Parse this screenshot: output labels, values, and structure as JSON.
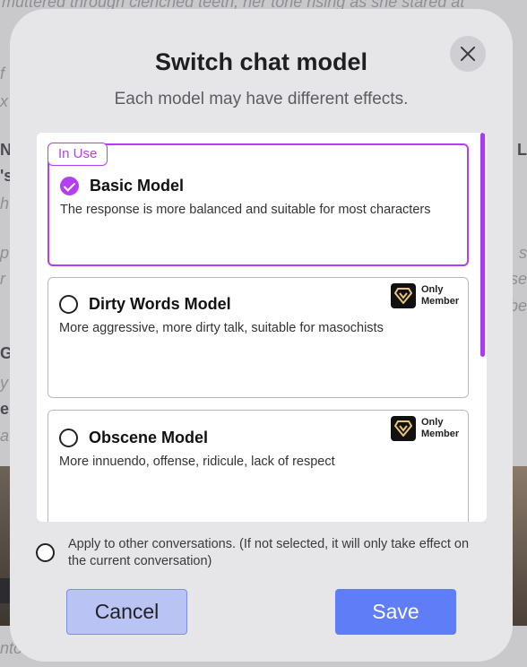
{
  "background": {
    "lines": [
      "muttered through clenched teeth, her tone rising as she stared at",
      "f",
      "x",
      "N",
      "'s",
      "h",
      "p",
      "r",
      "G",
      "y",
      "e",
      "a",
      "nto"
    ],
    "right_lines": [
      "L",
      "",
      "",
      "",
      "s",
      "se",
      "be"
    ]
  },
  "modal": {
    "title": "Switch chat model",
    "subtitle": "Each model may have different effects.",
    "close_icon": "close-icon"
  },
  "models": [
    {
      "name": "Basic Model",
      "description": "The response is more balanced and suitable for most characters",
      "selected": true,
      "tag": "In Use",
      "member_only": false
    },
    {
      "name": "Dirty Words Model",
      "description": "More aggressive, more dirty talk, suitable for masochists",
      "selected": false,
      "member_only": true,
      "badge_line1": "Only",
      "badge_line2": "Member"
    },
    {
      "name": "Obscene Model",
      "description": "More innuendo, offense, ridicule, lack of respect",
      "selected": false,
      "member_only": true,
      "badge_line1": "Only",
      "badge_line2": "Member"
    }
  ],
  "apply_option": {
    "label": "Apply to other conversations. (If not selected, it will only take effect on the current conversation)",
    "checked": false
  },
  "buttons": {
    "cancel": "Cancel",
    "save": "Save"
  },
  "colors": {
    "accent": "#b33ff0",
    "save": "#5f7df7",
    "cancel_bg": "#b9c3f4"
  }
}
